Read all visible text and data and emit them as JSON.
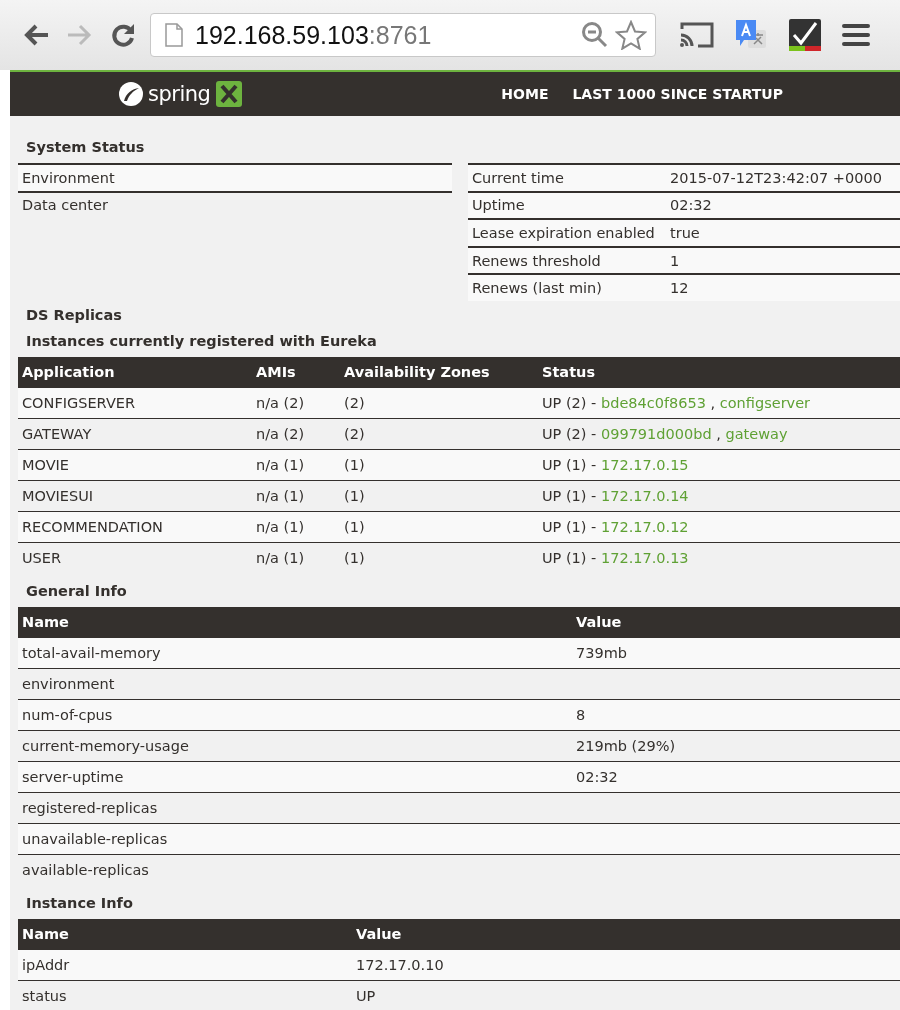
{
  "browser": {
    "url_host": "192.168.59.103",
    "url_port": ":8761"
  },
  "navbar": {
    "logo": "spring",
    "links": [
      "HOME",
      "LAST 1000 SINCE STARTUP"
    ]
  },
  "system_status": {
    "title": "System Status",
    "left_rows": [
      {
        "label": "Environment"
      },
      {
        "label": "Data center"
      }
    ],
    "right_rows": [
      {
        "label": "Current time",
        "value": "2015-07-12T23:42:07 +0000"
      },
      {
        "label": "Uptime",
        "value": "02:32"
      },
      {
        "label": "Lease expiration enabled",
        "value": "true"
      },
      {
        "label": "Renews threshold",
        "value": "1"
      },
      {
        "label": "Renews (last min)",
        "value": "12"
      }
    ]
  },
  "ds_replicas": {
    "title": "DS Replicas"
  },
  "instances": {
    "title": "Instances currently registered with Eureka",
    "columns": [
      "Application",
      "AMIs",
      "Availability Zones",
      "Status"
    ],
    "rows": [
      {
        "application": "CONFIGSERVER",
        "amis": "n/a (2)",
        "zones": "(2)",
        "status": "UP (2) -",
        "links": [
          "bde84c0f8653",
          "configserver"
        ],
        "link_separator": ","
      },
      {
        "application": "GATEWAY",
        "amis": "n/a (2)",
        "zones": "(2)",
        "status": "UP (2) -",
        "links": [
          "099791d000bd",
          "gateway"
        ],
        "link_separator": ","
      },
      {
        "application": "MOVIE",
        "amis": "n/a (1)",
        "zones": "(1)",
        "status": "UP (1) -",
        "links": [
          "172.17.0.15"
        ]
      },
      {
        "application": "MOVIESUI",
        "amis": "n/a (1)",
        "zones": "(1)",
        "status": "UP (1) -",
        "links": [
          "172.17.0.14"
        ]
      },
      {
        "application": "RECOMMENDATION",
        "amis": "n/a (1)",
        "zones": "(1)",
        "status": "UP (1) -",
        "links": [
          "172.17.0.12"
        ]
      },
      {
        "application": "USER",
        "amis": "n/a (1)",
        "zones": "(1)",
        "status": "UP (1) -",
        "links": [
          "172.17.0.13"
        ]
      }
    ]
  },
  "general_info": {
    "title": "General Info",
    "columns": [
      "Name",
      "Value"
    ],
    "rows": [
      {
        "name": "total-avail-memory",
        "value": "739mb"
      },
      {
        "name": "environment"
      },
      {
        "name": "num-of-cpus",
        "value": "8"
      },
      {
        "name": "current-memory-usage",
        "value": "219mb (29%)"
      },
      {
        "name": "server-uptime",
        "value": "02:32"
      },
      {
        "name": "registered-replicas"
      },
      {
        "name": "unavailable-replicas"
      },
      {
        "name": "available-replicas"
      }
    ]
  },
  "instance_info": {
    "title": "Instance Info",
    "columns": [
      "Name",
      "Value"
    ],
    "rows": [
      {
        "name": "ipAddr",
        "value": "172.17.0.10"
      },
      {
        "name": "status",
        "value": "UP"
      }
    ]
  }
}
